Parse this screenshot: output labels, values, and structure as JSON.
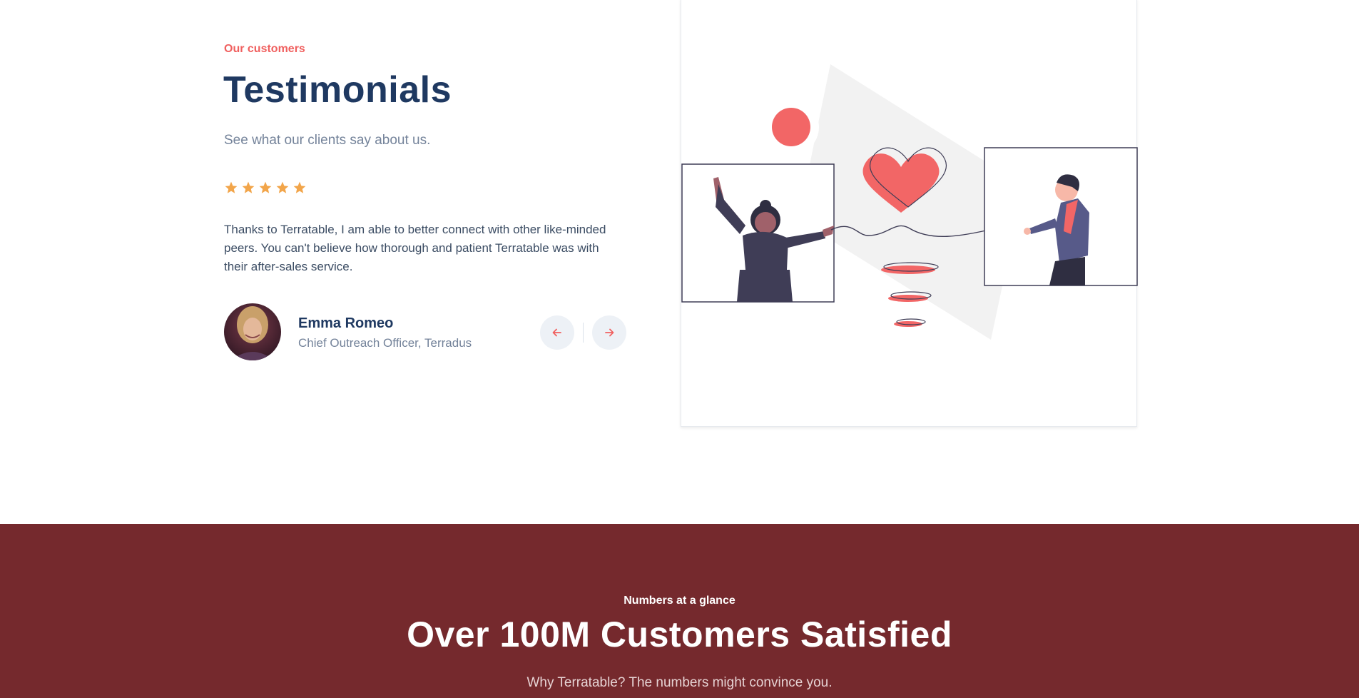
{
  "testimonials": {
    "eyebrow": "Our customers",
    "title": "Testimonials",
    "subtitle": "See what our clients say about us.",
    "rating": 5,
    "quote": "Thanks to Terratable, I am able to better connect with other like-minded peers. You can't believe how thorough and patient Terratable was with their after-sales service.",
    "author": {
      "name": "Emma Romeo",
      "role": "Chief Outreach Officer, Terradus"
    },
    "nav": {
      "prev_icon": "arrow-left-icon",
      "next_icon": "arrow-right-icon"
    },
    "colors": {
      "accent": "#f0605f",
      "heading": "#1f3961",
      "star": "#f2a54a"
    }
  },
  "stats": {
    "eyebrow": "Numbers at a glance",
    "title": "Over 100M Customers Satisfied",
    "subtitle": "Why Terratable? The numbers might convince you.",
    "background": "#75292d"
  }
}
